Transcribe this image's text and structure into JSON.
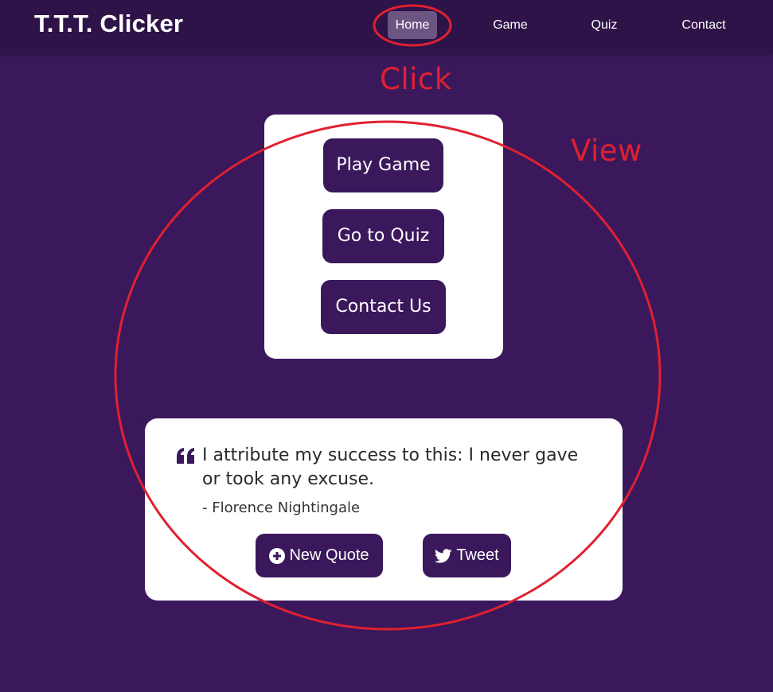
{
  "navbar": {
    "brand": "T.T.T. Clicker",
    "links": [
      "Home",
      "Game",
      "Quiz",
      "Contact"
    ],
    "active": "Home"
  },
  "menu": {
    "buttons": [
      "Play Game",
      "Go to Quiz",
      "Contact Us"
    ]
  },
  "quote": {
    "text": "I attribute my success to this: I never gave or took any excuse.",
    "author": "- Florence Nightingale",
    "new_quote_label": "New Quote",
    "tweet_label": "Tweet"
  },
  "annotations": {
    "click": "Click",
    "view": "View"
  },
  "icons": {
    "quote": "quote-left-icon",
    "new_quote": "plus-circle-icon",
    "tweet": "twitter-bird-icon"
  },
  "colors": {
    "background": "#3b185c",
    "navbar": "#2e1349",
    "active_link": "#6a5583",
    "card": "#ffffff",
    "annotation": "#e0202f"
  }
}
